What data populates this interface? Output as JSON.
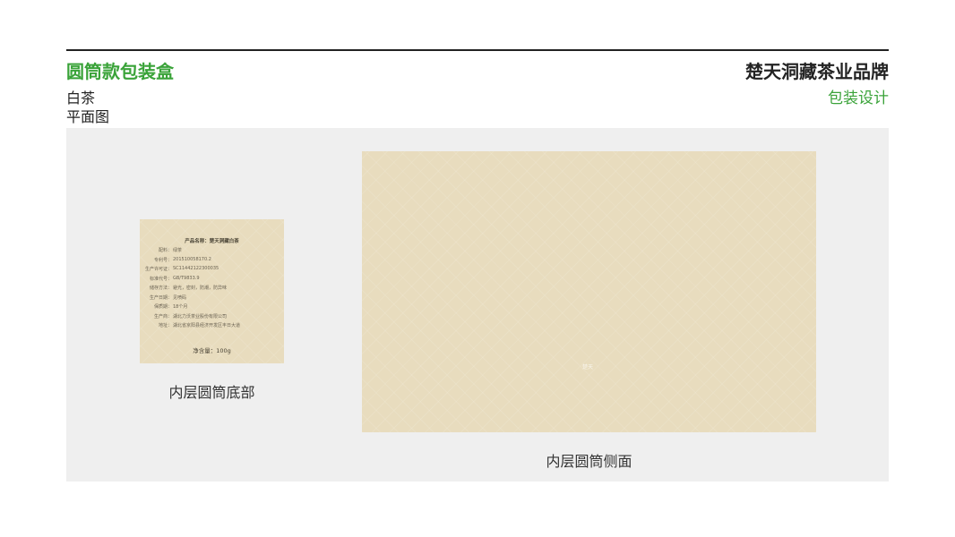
{
  "header": {
    "title": "圆筒款包装盒",
    "subtitle_1": "白茶",
    "subtitle_2": "平面图",
    "brand": "楚天洞藏茶业品牌",
    "brand_sub": "包装设计"
  },
  "bottom_panel": {
    "product_name": "产品名称：楚天洞藏白茶",
    "rows": [
      {
        "key": "配料：",
        "value": "绿茶"
      },
      {
        "key": "专利号：",
        "value": "201510058170.2"
      },
      {
        "key": "生产许可证：",
        "value": "SC11442122300035"
      },
      {
        "key": "标准代号：",
        "value": "GB/T9833.9"
      },
      {
        "key": "储存方法：",
        "value": "避光，密封，防潮，防异味"
      },
      {
        "key": "生产日期：",
        "value": "见喷码"
      },
      {
        "key": "保质期：",
        "value": "18个月"
      },
      {
        "key": "生产商：",
        "value": "湖北力沃茶业股份有限公司"
      },
      {
        "key": "地址：",
        "value": "湖北省京阳县经济开发区丰日大道"
      }
    ],
    "net_content": "净含量：100g",
    "caption": "内层圆筒底部"
  },
  "side_panel": {
    "mark": "楚天",
    "caption": "内层圆筒侧面"
  }
}
